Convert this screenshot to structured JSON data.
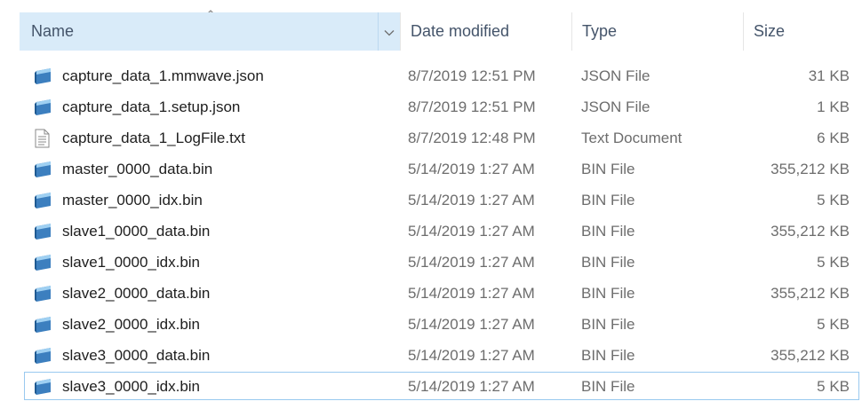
{
  "columns": {
    "name": "Name",
    "date": "Date modified",
    "type": "Type",
    "size": "Size",
    "sort_icon": "chevron-up-icon",
    "dropdown_icon": "chevron-down-icon"
  },
  "colors": {
    "header_active_bg": "#d9ebf9",
    "selection_border": "#99c9ef"
  },
  "files": [
    {
      "name": "capture_data_1.mmwave.json",
      "date": "8/7/2019 12:51 PM",
      "type": "JSON File",
      "size": "31 KB",
      "icon": "file-icon"
    },
    {
      "name": "capture_data_1.setup.json",
      "date": "8/7/2019 12:51 PM",
      "type": "JSON File",
      "size": "1 KB",
      "icon": "file-icon"
    },
    {
      "name": "capture_data_1_LogFile.txt",
      "date": "8/7/2019 12:48 PM",
      "type": "Text Document",
      "size": "6 KB",
      "icon": "text-document-icon"
    },
    {
      "name": "master_0000_data.bin",
      "date": "5/14/2019 1:27 AM",
      "type": "BIN File",
      "size": "355,212 KB",
      "icon": "file-icon"
    },
    {
      "name": "master_0000_idx.bin",
      "date": "5/14/2019 1:27 AM",
      "type": "BIN File",
      "size": "5 KB",
      "icon": "file-icon"
    },
    {
      "name": "slave1_0000_data.bin",
      "date": "5/14/2019 1:27 AM",
      "type": "BIN File",
      "size": "355,212 KB",
      "icon": "file-icon"
    },
    {
      "name": "slave1_0000_idx.bin",
      "date": "5/14/2019 1:27 AM",
      "type": "BIN File",
      "size": "5 KB",
      "icon": "file-icon"
    },
    {
      "name": "slave2_0000_data.bin",
      "date": "5/14/2019 1:27 AM",
      "type": "BIN File",
      "size": "355,212 KB",
      "icon": "file-icon"
    },
    {
      "name": "slave2_0000_idx.bin",
      "date": "5/14/2019 1:27 AM",
      "type": "BIN File",
      "size": "5 KB",
      "icon": "file-icon"
    },
    {
      "name": "slave3_0000_data.bin",
      "date": "5/14/2019 1:27 AM",
      "type": "BIN File",
      "size": "355,212 KB",
      "icon": "file-icon"
    },
    {
      "name": "slave3_0000_idx.bin",
      "date": "5/14/2019 1:27 AM",
      "type": "BIN File",
      "size": "5 KB",
      "icon": "file-icon",
      "selected": true
    }
  ]
}
